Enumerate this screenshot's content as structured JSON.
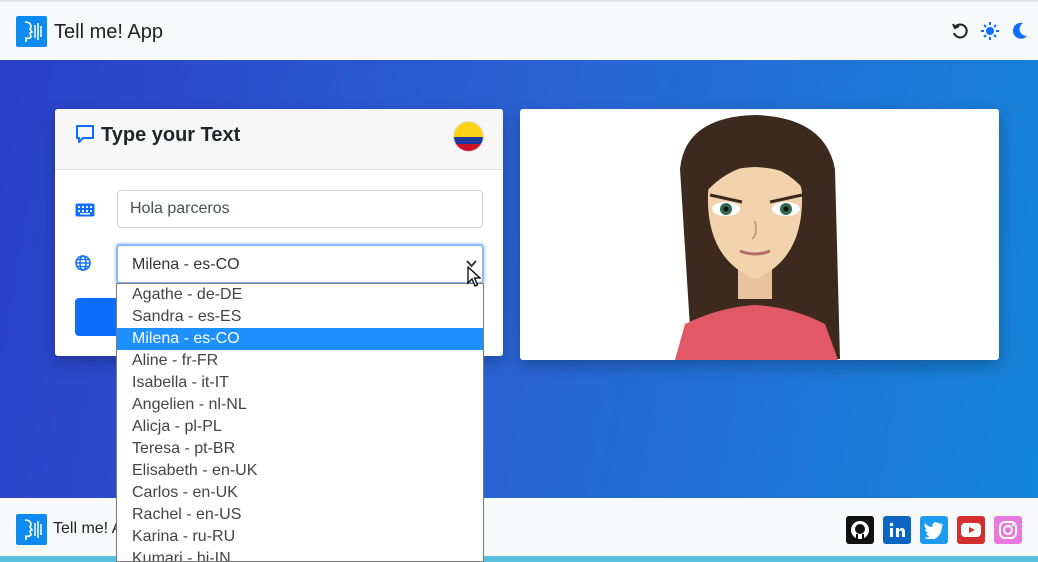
{
  "app": {
    "brand": "Tell me! App"
  },
  "toolbar": {
    "icons": [
      "reset-icon",
      "sun-icon",
      "moon-icon"
    ]
  },
  "card": {
    "title": "Type your Text",
    "text_input": {
      "value": "Hola parceros"
    },
    "voice_select": {
      "selected": "Milena - es-CO"
    },
    "flag": "colombia-flag"
  },
  "dropdown": {
    "options": [
      "Agathe - de-DE",
      "Sandra - es-ES",
      "Milena - es-CO",
      "Aline - fr-FR",
      "Isabella - it-IT",
      "Angelien - nl-NL",
      "Alicja - pl-PL",
      "Teresa - pt-BR",
      "Elisabeth - en-UK",
      "Carlos - en-UK",
      "Rachel - en-US",
      "Karina - ru-RU",
      "Kumari - hi-IN"
    ],
    "highlighted_index": 2
  },
  "footer": {
    "brand": "Tell me! A",
    "social": [
      "github-icon",
      "linkedin-icon",
      "twitter-icon",
      "youtube-icon",
      "instagram-icon"
    ]
  },
  "colors": {
    "primary": "#0d6efd",
    "hero_start": "#2b3fc7",
    "hero_end": "#1485d8",
    "highlight": "#1e90ff"
  }
}
